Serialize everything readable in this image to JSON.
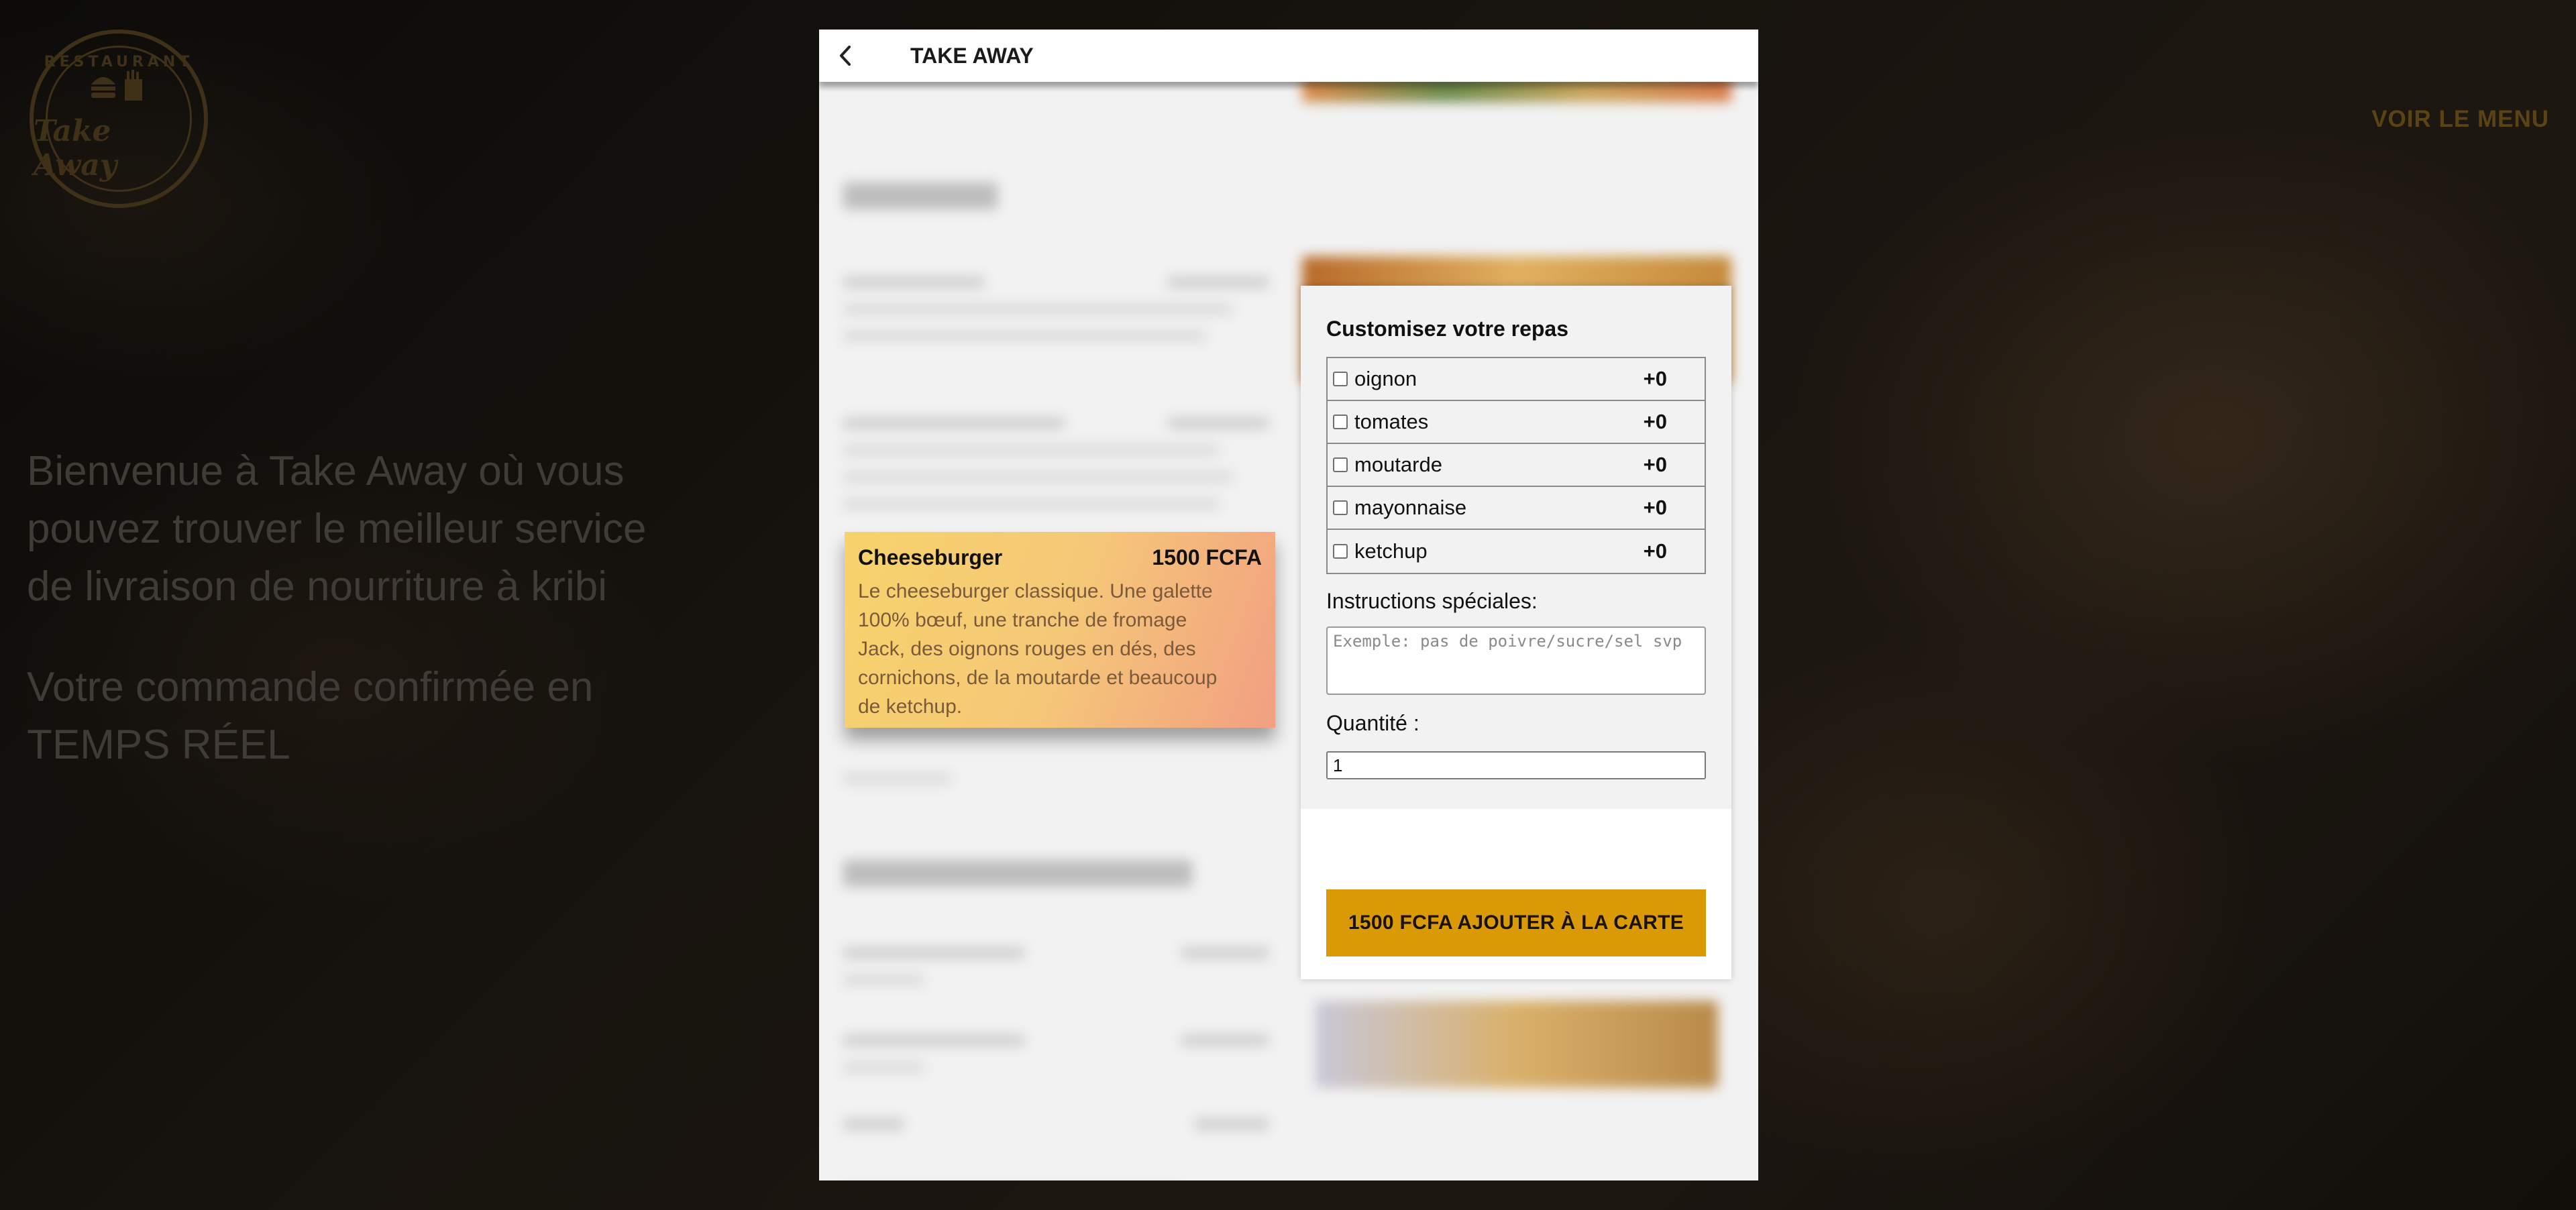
{
  "background": {
    "logo": {
      "top_text": "RESTAURANT",
      "name": "Take Away",
      "icon": "burger-and-fries-icon"
    },
    "nav": {
      "menu_link": "VOIR LE MENU"
    },
    "welcome": {
      "line1": "Bienvenue à Take Away où vous pouvez trouver le meilleur service de livraison de nourriture à kribi",
      "line2": "Votre commande confirmée en TEMPS RÉEL"
    }
  },
  "modal": {
    "title": "TAKE AWAY",
    "back_icon": "chevron-left-icon"
  },
  "item": {
    "name": "Cheeseburger",
    "price": "1500 FCFA",
    "description": "Le cheeseburger classique. Une galette 100% bœuf, une tranche de fromage Jack, des oignons rouges en dés, des cornichons, de la moutarde et beaucoup de ketchup."
  },
  "customize": {
    "title": "Customisez votre repas",
    "options": [
      {
        "label": "oignon",
        "price": "+0",
        "checked": false
      },
      {
        "label": "tomates",
        "price": "+0",
        "checked": false
      },
      {
        "label": "moutarde",
        "price": "+0",
        "checked": false
      },
      {
        "label": "mayonnaise",
        "price": "+0",
        "checked": false
      },
      {
        "label": "ketchup",
        "price": "+0",
        "checked": false
      }
    ],
    "instructions_label": "Instructions spéciales:",
    "instructions_placeholder": "Exemple: pas de poivre/sucre/sel svp",
    "instructions_value": "",
    "quantity_label": "Quantité :",
    "quantity_value": "1",
    "add_button": "1500 FCFA AJOUTER À LA CARTE"
  },
  "colors": {
    "accent": "#d99a06",
    "card_gradient_start": "#f7d36b",
    "card_gradient_end": "#f29f82"
  }
}
